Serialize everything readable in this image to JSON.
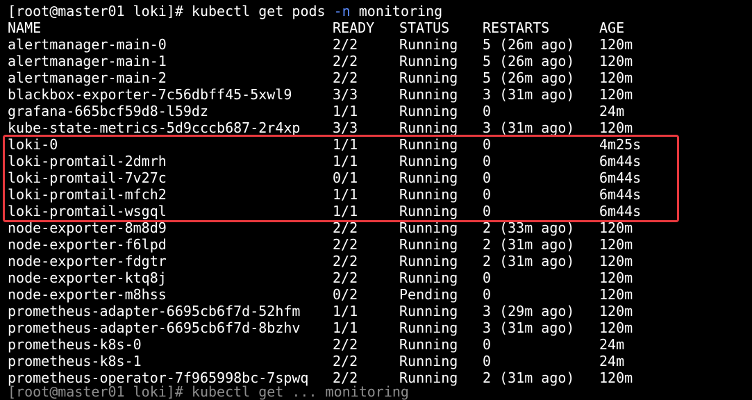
{
  "prompt": {
    "user_host": "[root@master01 loki]# ",
    "command": "kubectl get pods ",
    "flag": "-n",
    "arg": " monitoring"
  },
  "headers": {
    "name": "NAME",
    "ready": "READY",
    "status": "STATUS",
    "restarts": "RESTARTS",
    "age": "AGE"
  },
  "pods": [
    {
      "name": "alertmanager-main-0",
      "ready": "2/2",
      "status": "Running",
      "restarts": "5 (26m ago)",
      "age": "120m"
    },
    {
      "name": "alertmanager-main-1",
      "ready": "2/2",
      "status": "Running",
      "restarts": "5 (26m ago)",
      "age": "120m"
    },
    {
      "name": "alertmanager-main-2",
      "ready": "2/2",
      "status": "Running",
      "restarts": "5 (26m ago)",
      "age": "120m"
    },
    {
      "name": "blackbox-exporter-7c56dbff45-5xwl9",
      "ready": "3/3",
      "status": "Running",
      "restarts": "3 (31m ago)",
      "age": "120m"
    },
    {
      "name": "grafana-665bcf59d8-l59dz",
      "ready": "1/1",
      "status": "Running",
      "restarts": "0",
      "age": "24m"
    },
    {
      "name": "kube-state-metrics-5d9cccb687-2r4xp",
      "ready": "3/3",
      "status": "Running",
      "restarts": "3 (31m ago)",
      "age": "120m"
    },
    {
      "name": "loki-0",
      "ready": "1/1",
      "status": "Running",
      "restarts": "0",
      "age": "4m25s"
    },
    {
      "name": "loki-promtail-2dmrh",
      "ready": "1/1",
      "status": "Running",
      "restarts": "0",
      "age": "6m44s"
    },
    {
      "name": "loki-promtail-7v27c",
      "ready": "0/1",
      "status": "Running",
      "restarts": "0",
      "age": "6m44s"
    },
    {
      "name": "loki-promtail-mfch2",
      "ready": "1/1",
      "status": "Running",
      "restarts": "0",
      "age": "6m44s"
    },
    {
      "name": "loki-promtail-wsgql",
      "ready": "1/1",
      "status": "Running",
      "restarts": "0",
      "age": "6m44s"
    },
    {
      "name": "node-exporter-8m8d9",
      "ready": "2/2",
      "status": "Running",
      "restarts": "2 (33m ago)",
      "age": "120m"
    },
    {
      "name": "node-exporter-f6lpd",
      "ready": "2/2",
      "status": "Running",
      "restarts": "2 (31m ago)",
      "age": "120m"
    },
    {
      "name": "node-exporter-fdgtr",
      "ready": "2/2",
      "status": "Running",
      "restarts": "2 (31m ago)",
      "age": "120m"
    },
    {
      "name": "node-exporter-ktq8j",
      "ready": "2/2",
      "status": "Running",
      "restarts": "0",
      "age": "120m"
    },
    {
      "name": "node-exporter-m8hss",
      "ready": "0/2",
      "status": "Pending",
      "restarts": "0",
      "age": "120m"
    },
    {
      "name": "prometheus-adapter-6695cb6f7d-52hfm",
      "ready": "1/1",
      "status": "Running",
      "restarts": "3 (29m ago)",
      "age": "120m"
    },
    {
      "name": "prometheus-adapter-6695cb6f7d-8bzhv",
      "ready": "1/1",
      "status": "Running",
      "restarts": "3 (31m ago)",
      "age": "120m"
    },
    {
      "name": "prometheus-k8s-0",
      "ready": "2/2",
      "status": "Running",
      "restarts": "0",
      "age": "24m"
    },
    {
      "name": "prometheus-k8s-1",
      "ready": "2/2",
      "status": "Running",
      "restarts": "0",
      "age": "24m"
    },
    {
      "name": "prometheus-operator-7f965998bc-7spwq",
      "ready": "2/2",
      "status": "Running",
      "restarts": "2 (31m ago)",
      "age": "120m"
    }
  ],
  "next_prompt": "[root@master01 loki]# kubectl get ... monitoring",
  "colors": {
    "background": "#000000",
    "text": "#ffffff",
    "flag": "#5b8cff",
    "highlight": "#e8383d"
  }
}
